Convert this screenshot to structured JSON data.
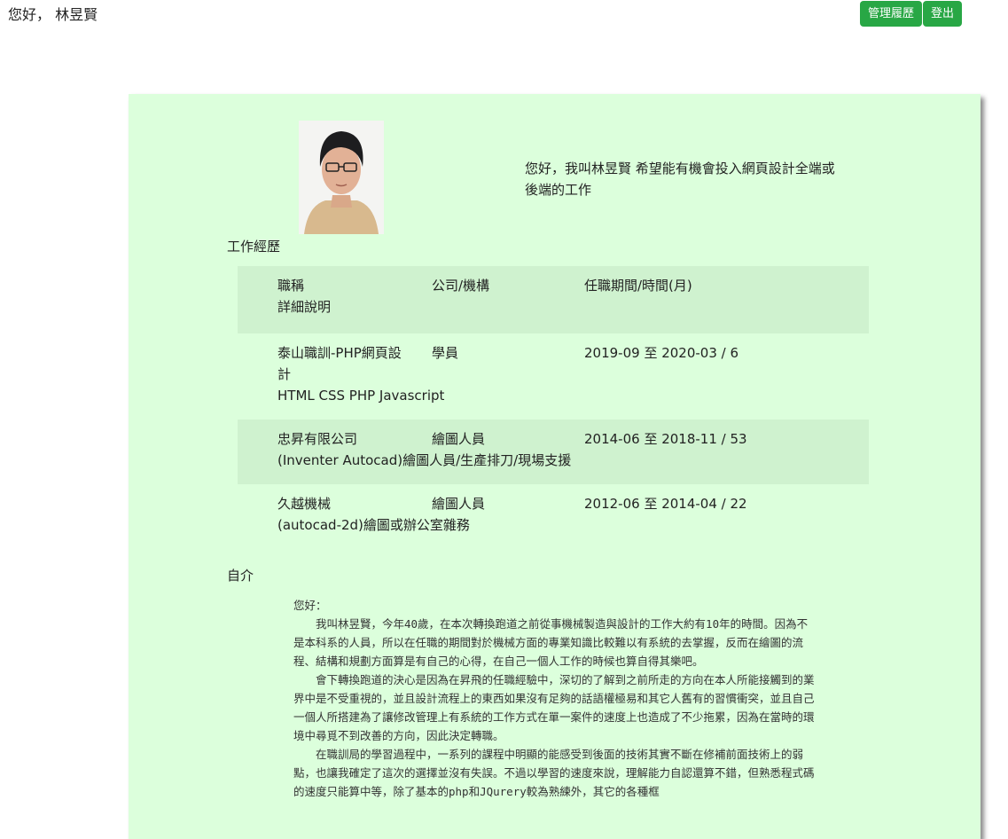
{
  "header": {
    "greeting": "您好， 林昱賢",
    "manage_label": "管理履歷",
    "logout_label": "登出"
  },
  "intro": "您好，我叫林昱賢 希望能有機會投入網頁設計全端或後端的工作",
  "work": {
    "title": "工作經歷",
    "header": {
      "title": "職稱",
      "company": "公司/機構",
      "period": "任職期間/時間(月)",
      "detail": "詳細說明"
    },
    "rows": [
      {
        "title": "泰山職訓-PHP網頁設計",
        "company": "學員",
        "period": "2019-09 至 2020-03 / 6",
        "detail": "HTML CSS PHP Javascript"
      },
      {
        "title": "忠昇有限公司",
        "company": "繪圖人員",
        "period": "2014-06 至 2018-11 / 53",
        "detail": "(Inventer Autocad)繪圖人員/生產排刀/現場支援"
      },
      {
        "title": "久越機械",
        "company": "繪圖人員",
        "period": "2012-06 至 2014-04 / 22",
        "detail": "(autocad-2d)繪圖或辦公室雜務"
      }
    ]
  },
  "self": {
    "title": "自介",
    "salutation": "您好：",
    "paragraphs": [
      "我叫林昱賢，今年40歲，在本次轉換跑道之前從事機械製造與設計的工作大約有10年的時間。因為不是本科系的人員，所以在任職的期間對於機械方面的專業知識比較難以有系統的去掌握，反而在繪圖的流程、結構和規劃方面算是有自己的心得，在自己一個人工作的時候也算自得其樂吧。",
      "會下轉換跑道的決心是因為在昇飛的任職經驗中，深切的了解到之前所走的方向在本人所能接觸到的業界中是不受重視的，並且設計流程上的東西如果沒有足夠的話語權極易和其它人舊有的習慣衝突，並且自己一個人所搭建為了讓修改管理上有系統的工作方式在單一案件的速度上也造成了不少拖累，因為在當時的環境中尋覓不到改善的方向，因此決定轉職。",
      "在職訓局的學習過程中，一系列的課程中明顯的能感受到後面的技術其實不斷在修補前面技術上的弱點，也讓我確定了這次的選擇並沒有失誤。不過以學習的速度來說，理解能力自認還算不錯，但熟悉程式碼的速度只能算中等，除了基本的php和JQurery較為熟練外，其它的各種框"
    ]
  }
}
